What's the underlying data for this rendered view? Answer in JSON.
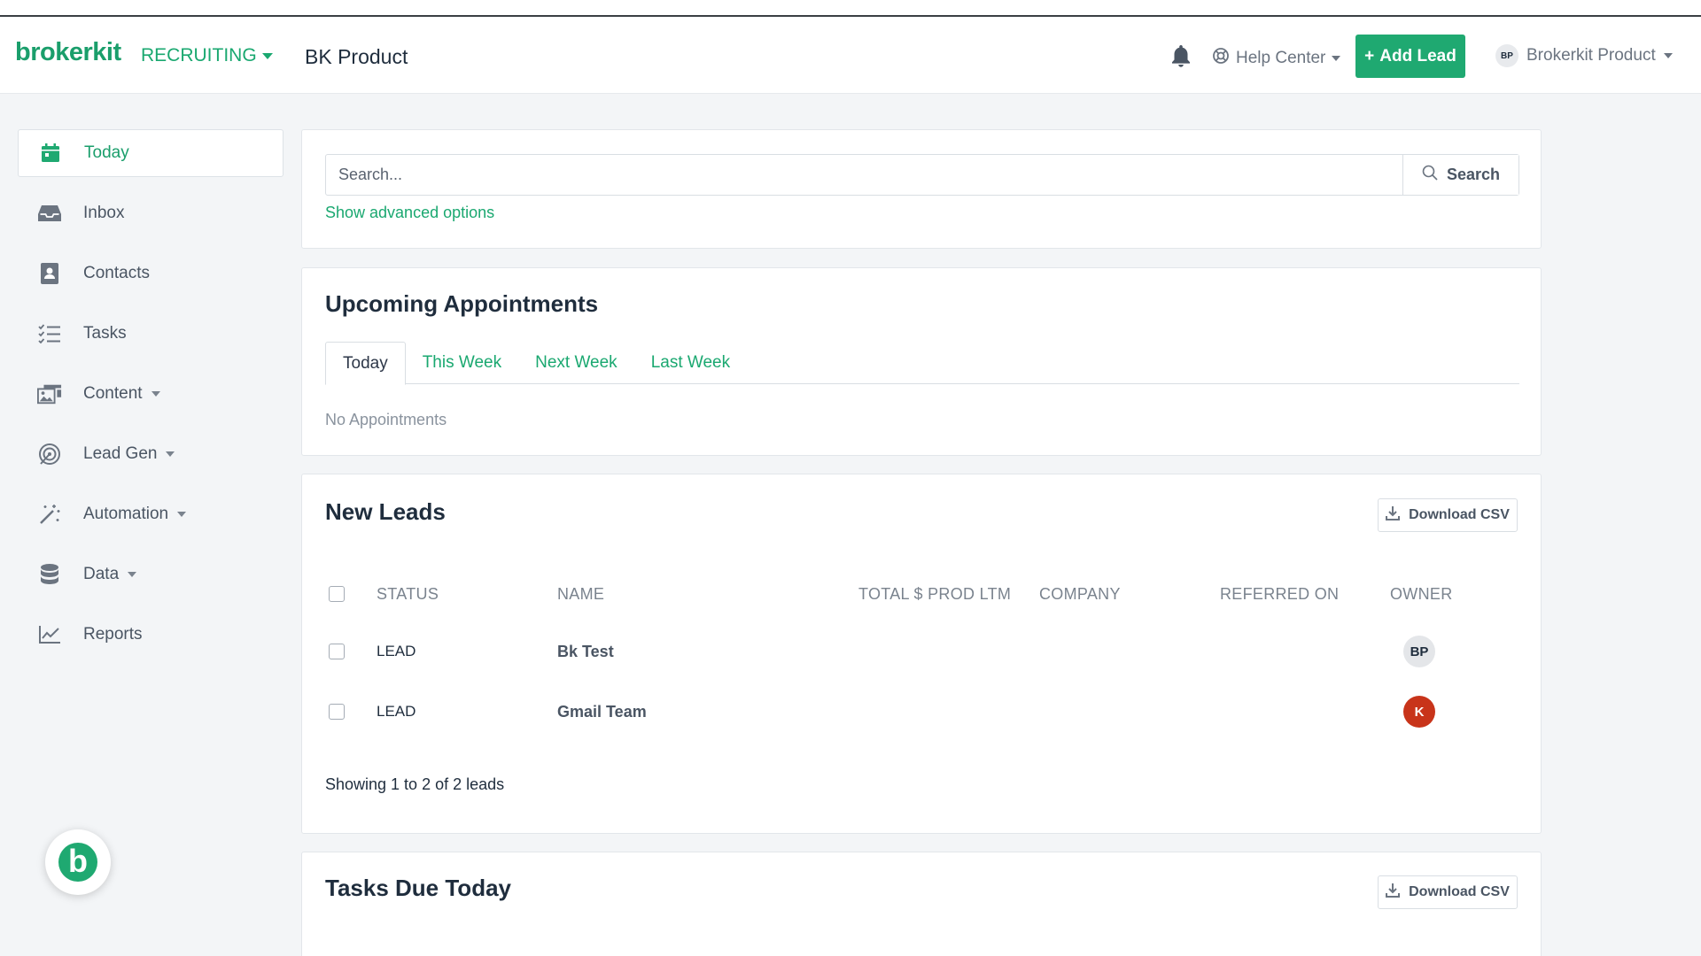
{
  "header": {
    "logo": "brokerkit",
    "app_switch": "RECRUITING",
    "page_name": "BK Product",
    "help_center": "Help Center",
    "add_lead": "Add Lead",
    "add_lead_icon": "+",
    "user_initials": "BP",
    "user_name": "Brokerkit Product"
  },
  "sidebar": {
    "items": [
      {
        "label": "Today",
        "icon": "calendar-icon"
      },
      {
        "label": "Inbox",
        "icon": "inbox-icon"
      },
      {
        "label": "Contacts",
        "icon": "contacts-icon"
      },
      {
        "label": "Tasks",
        "icon": "tasks-icon"
      },
      {
        "label": "Content",
        "icon": "content-icon"
      },
      {
        "label": "Lead Gen",
        "icon": "target-icon"
      },
      {
        "label": "Automation",
        "icon": "magic-wand-icon"
      },
      {
        "label": "Data",
        "icon": "database-icon"
      },
      {
        "label": "Reports",
        "icon": "chart-icon"
      }
    ],
    "fab_letter": "b"
  },
  "search": {
    "placeholder": "Search...",
    "button": "Search",
    "advanced": "Show advanced options"
  },
  "appointments": {
    "title": "Upcoming Appointments",
    "tabs": [
      "Today",
      "This Week",
      "Next Week",
      "Last Week"
    ],
    "active_tab": "Today",
    "empty": "No Appointments"
  },
  "leads": {
    "title": "New Leads",
    "download": "Download CSV",
    "columns": [
      "STATUS",
      "NAME",
      "TOTAL $ PROD LTM",
      "COMPANY",
      "REFERRED ON",
      "OWNER"
    ],
    "rows": [
      {
        "status": "LEAD",
        "name": "Bk Test",
        "prod": "",
        "company": "",
        "referred": "",
        "owner": "BP",
        "owner_bg": "#e4e6e9",
        "owner_fg": "#1f2d3d"
      },
      {
        "status": "LEAD",
        "name": "Gmail Team",
        "prod": "",
        "company": "",
        "referred": "",
        "owner": "K",
        "owner_bg": "#c8341a",
        "owner_fg": "#ffffff"
      }
    ],
    "footer": "Showing 1 to 2 of 2 leads"
  },
  "tasks": {
    "title": "Tasks Due Today",
    "download": "Download CSV"
  },
  "colors": {
    "brand": "#1fa971",
    "link": "#1aa870"
  }
}
